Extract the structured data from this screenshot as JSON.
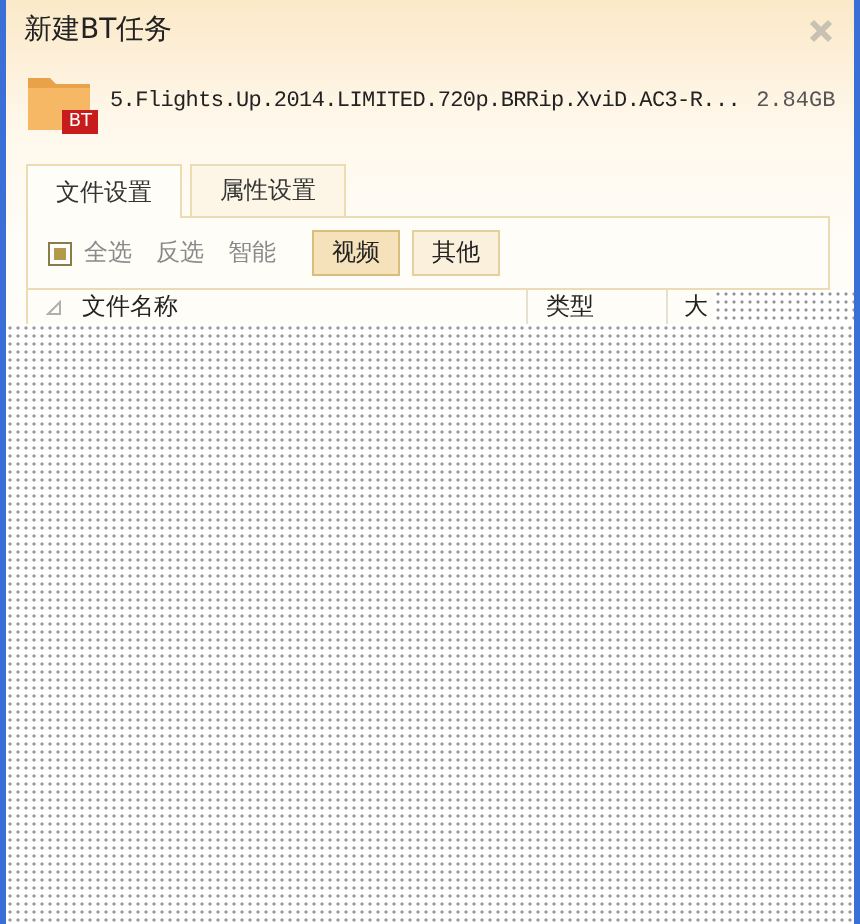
{
  "window": {
    "title": "新建BT任务"
  },
  "file": {
    "badge": "BT",
    "name": "5.Flights.Up.2014.LIMITED.720p.BRRip.XviD.AC3-R...",
    "size": "2.84GB"
  },
  "tabs": [
    {
      "label": "文件设置",
      "selected": true
    },
    {
      "label": "属性设置",
      "selected": false
    }
  ],
  "toolbar": {
    "select_all": {
      "label": "全选",
      "checked": true
    },
    "links": [
      "反选",
      "智能"
    ],
    "filters": [
      {
        "label": "视频",
        "selected": true
      },
      {
        "label": "其他",
        "selected": false
      }
    ]
  },
  "table": {
    "columns": [
      "文件名称",
      "类型",
      "大"
    ]
  }
}
